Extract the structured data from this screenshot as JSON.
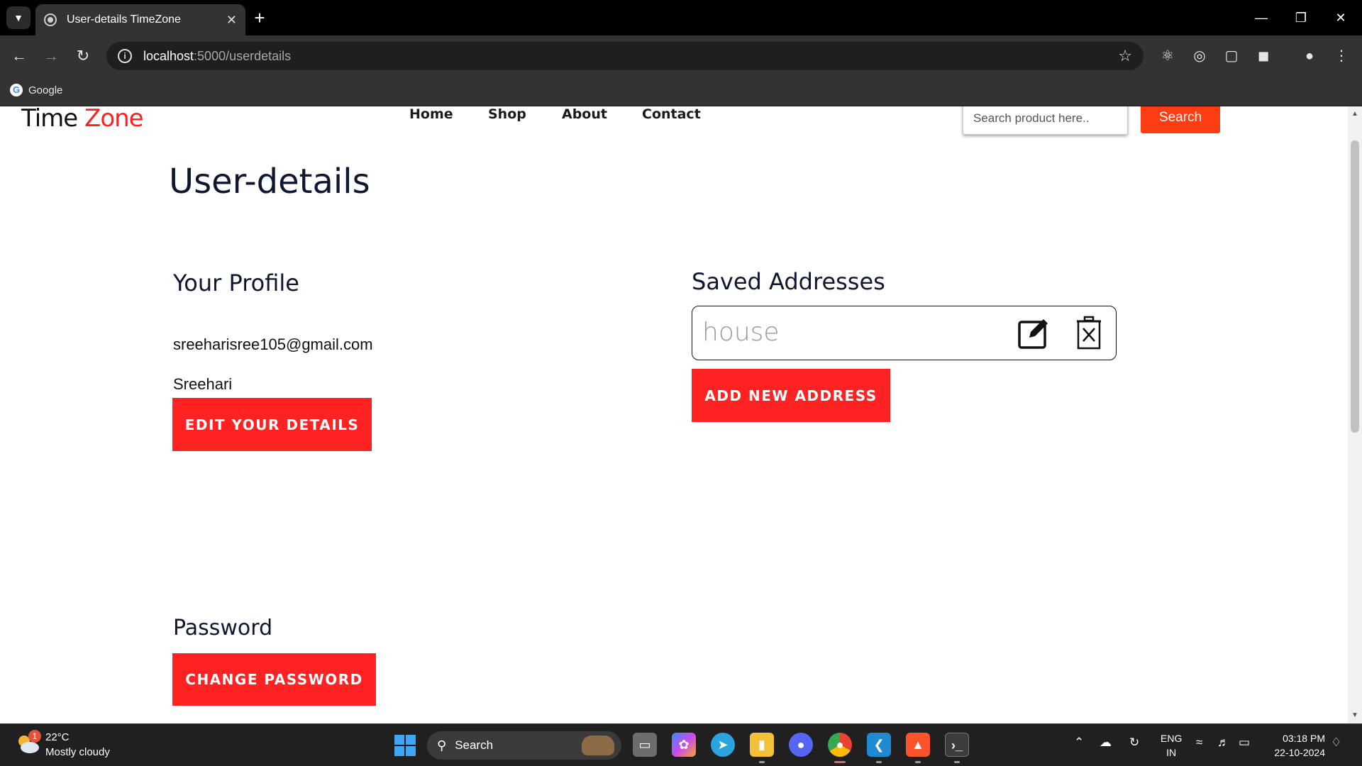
{
  "browser": {
    "tab_title": "User-details TimeZone",
    "url_host": "localhost",
    "url_path": ":5000/userdetails",
    "bookmark": "Google"
  },
  "site": {
    "logo_part1": "Time",
    "logo_part2": "Zone",
    "nav": [
      "Home",
      "Shop",
      "About",
      "Contact"
    ],
    "search_placeholder": "Search product here..",
    "search_button": "Search"
  },
  "page": {
    "title": "User-details",
    "profile": {
      "heading": "Your Profile",
      "email": "sreeharisree105@gmail.com",
      "name": "Sreehari",
      "edit_button": "EDIT YOUR DETAILS"
    },
    "addresses": {
      "heading": "Saved Addresses",
      "items": [
        {
          "name": "house"
        }
      ],
      "add_button": "ADD NEW ADDRESS"
    },
    "password": {
      "heading": "Password",
      "change_button": "CHANGE PASSWORD"
    }
  },
  "taskbar": {
    "weather_badge": "1",
    "temperature": "22°C",
    "weather": "Mostly cloudy",
    "search_label": "Search",
    "lang_1": "ENG",
    "lang_2": "IN",
    "time": "03:18 PM",
    "date": "22-10-2024"
  },
  "colors": {
    "accent_red": "#ff2222",
    "search_orange": "#ff3d12",
    "heading_navy": "#0f1730"
  }
}
